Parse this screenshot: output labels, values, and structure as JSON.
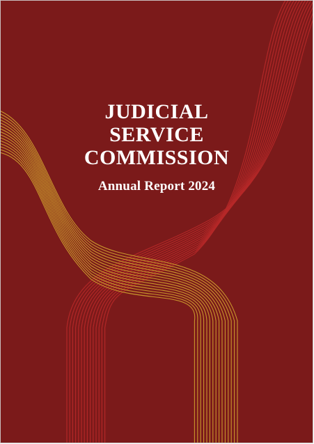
{
  "document": {
    "title_lines": [
      "JUDICIAL",
      "SERVICE",
      "COMMISSION"
    ],
    "subtitle": "Annual Report 2024"
  },
  "colors": {
    "background": "#7b1a1a",
    "red_lines": "#b52828",
    "gold_lines": "#c9962c",
    "text": "#ffffff"
  }
}
